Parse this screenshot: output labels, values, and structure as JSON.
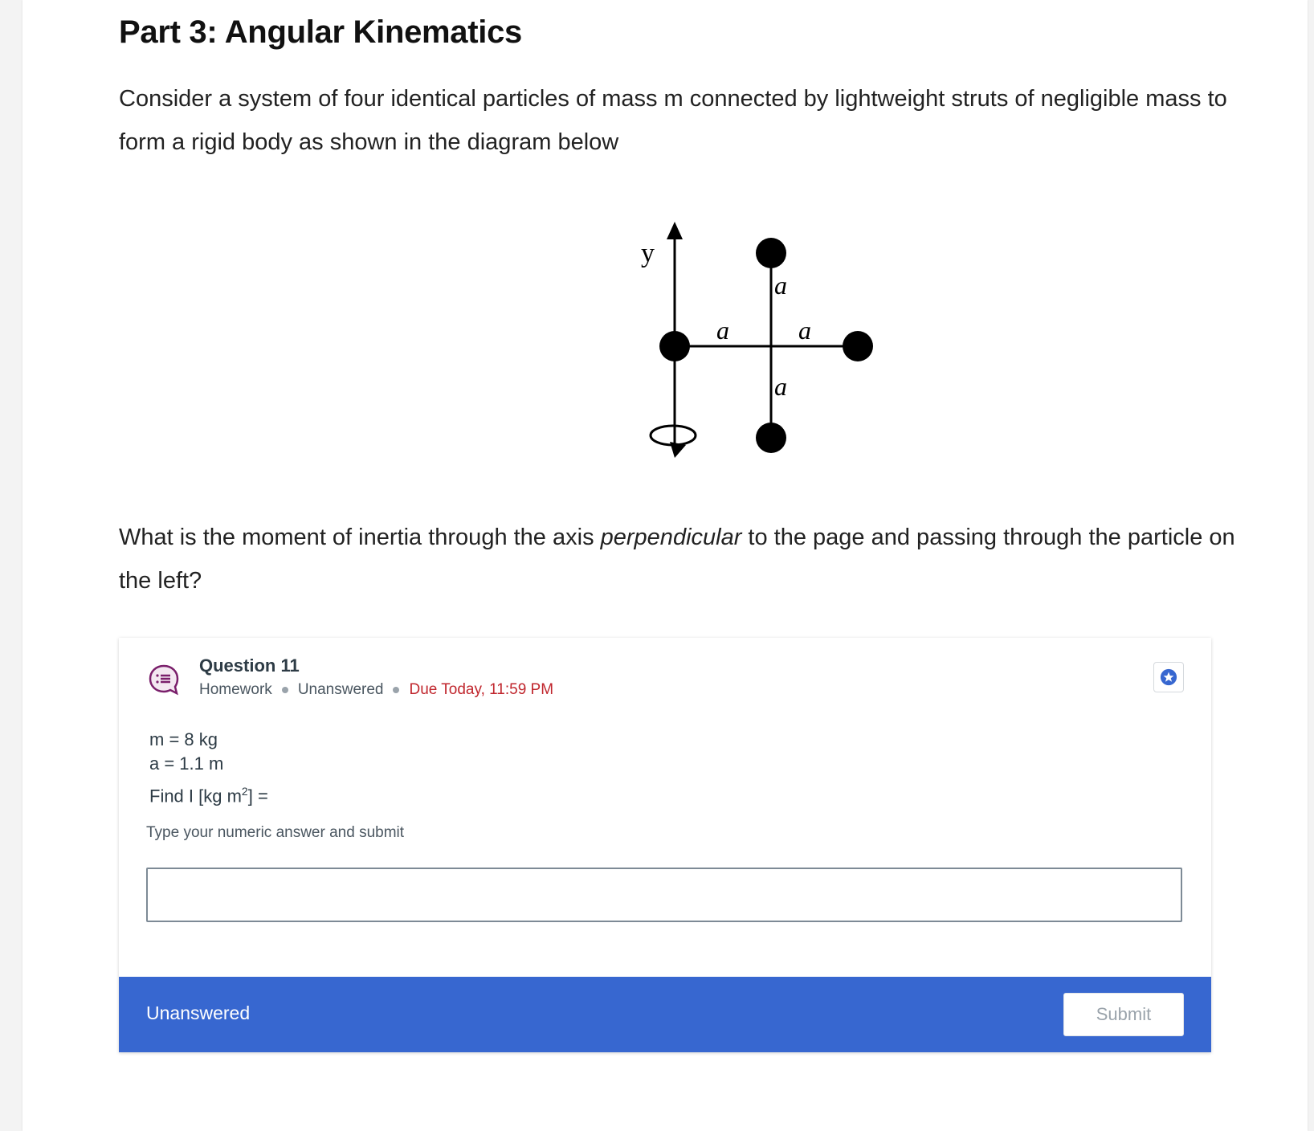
{
  "header": {
    "title": "Part 3: Angular Kinematics"
  },
  "problem": {
    "intro": "Consider a system of four identical particles of mass m connected by lightweight struts of negligible mass to form a rigid body as shown in the diagram below",
    "question_before": "What is the moment of inertia through the axis ",
    "question_emphasis": "perpendicular",
    "question_after": " to the page and passing through the particle on the left?"
  },
  "diagram": {
    "axis_label": "y",
    "segment_label": "a"
  },
  "question_card": {
    "title": "Question 11",
    "type": "Homework",
    "status": "Unanswered",
    "due": "Due Today, 11:59 PM",
    "givens": {
      "mass": "m = 8 kg",
      "length": "a = 1.1 m",
      "find_prefix": "Find I [kg m",
      "find_exponent": "2",
      "find_suffix": "] ="
    },
    "instruction": "Type your numeric answer and submit",
    "answer_placeholder": "",
    "footer_status": "Unanswered",
    "submit_label": "Submit"
  },
  "colors": {
    "footer_bar": "#3767d0",
    "due_text": "#c0262d",
    "question_icon": "#7a1f6b",
    "star_icon": "#3767d0"
  },
  "icons": {
    "question": "question-list-icon",
    "star": "star-icon"
  }
}
